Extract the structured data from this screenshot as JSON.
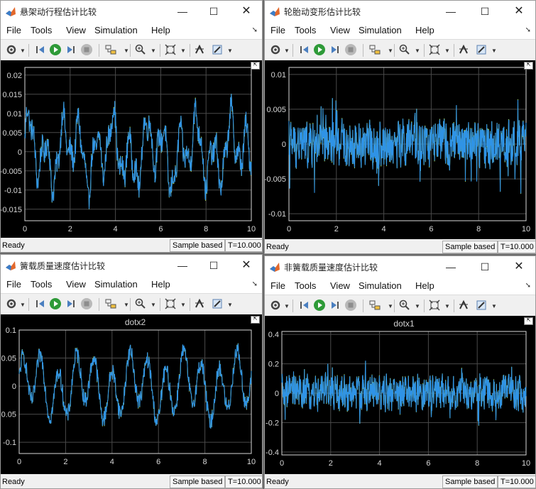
{
  "menu": [
    "File",
    "Tools",
    "View",
    "Simulation",
    "Help"
  ],
  "colors": {
    "series_blue": "#2f93e6",
    "series_green": "#c7f04b",
    "axes": "#d8d8d8",
    "grid": "#4a4a4a"
  },
  "toolbar_icons": [
    "gear-icon",
    "step-back-icon",
    "run-icon",
    "step-forward-icon",
    "stop-icon",
    "highlight-block-icon",
    "zoom-icon",
    "fit-to-view-icon",
    "cursor-measure-icon",
    "style-icon"
  ],
  "windows": [
    {
      "title": "悬架动行程估计比较",
      "plot_title": "",
      "status": {
        "ready": "Ready",
        "sample": "Sample based",
        "time": "T=10.000"
      },
      "chart_data": {
        "type": "line",
        "xlim": [
          0,
          10
        ],
        "ylim": [
          -0.018,
          0.022
        ],
        "x_ticks": [
          "0",
          "2",
          "4",
          "6",
          "8",
          "10"
        ],
        "y_ticks": [
          "-0.015",
          "-0.01",
          "-0.005",
          "0",
          "0.005",
          "0.01",
          "0.015",
          "0.02"
        ],
        "y_tick_values": [
          -0.015,
          -0.01,
          -0.005,
          0,
          0.005,
          0.01,
          0.015,
          0.02
        ],
        "grid": true,
        "series_count": 2
      }
    },
    {
      "title": "轮胎动变形估计比较",
      "plot_title": "",
      "status": {
        "ready": "Ready",
        "sample": "Sample based",
        "time": "T=10.000"
      },
      "chart_data": {
        "type": "line",
        "xlim": [
          0,
          10
        ],
        "ylim": [
          -0.011,
          0.011
        ],
        "x_ticks": [
          "0",
          "2",
          "4",
          "6",
          "8",
          "10"
        ],
        "y_ticks": [
          "-0.01",
          "-0.005",
          "0",
          "0.005",
          "0.01"
        ],
        "y_tick_values": [
          -0.01,
          -0.005,
          0,
          0.005,
          0.01
        ],
        "grid": true,
        "series_count": 2
      }
    },
    {
      "title": "簧载质量速度估计比较",
      "plot_title": "dotx2",
      "status": {
        "ready": "Ready",
        "sample": "Sample based",
        "time": "T=10.000"
      },
      "chart_data": {
        "type": "line",
        "xlim": [
          0,
          10
        ],
        "ylim": [
          -0.12,
          0.1
        ],
        "x_ticks": [
          "0",
          "2",
          "4",
          "6",
          "8",
          "10"
        ],
        "y_ticks": [
          "-0.1",
          "-0.05",
          "0",
          "0.05",
          "0.1"
        ],
        "y_tick_values": [
          -0.1,
          -0.05,
          0,
          0.05,
          0.1
        ],
        "grid": true,
        "series_count": 2
      }
    },
    {
      "title": "非簧载质量速度估计比较",
      "plot_title": "dotx1",
      "status": {
        "ready": "Ready",
        "sample": "Sample based",
        "time": "T=10.000"
      },
      "chart_data": {
        "type": "line",
        "xlim": [
          0,
          10
        ],
        "ylim": [
          -0.42,
          0.42
        ],
        "x_ticks": [
          "0",
          "2",
          "4",
          "6",
          "8",
          "10"
        ],
        "y_ticks": [
          "-0.4",
          "-0.2",
          "0",
          "0.2",
          "0.4"
        ],
        "y_tick_values": [
          -0.4,
          -0.2,
          0,
          0.2,
          0.4
        ],
        "grid": true,
        "series_count": 2
      }
    }
  ]
}
